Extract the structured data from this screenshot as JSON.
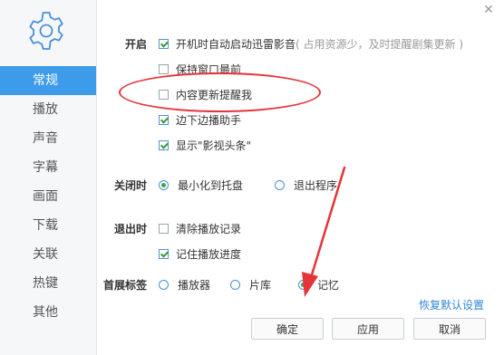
{
  "sidebar": {
    "items": [
      {
        "label": "常规",
        "active": true
      },
      {
        "label": "播放"
      },
      {
        "label": "声音"
      },
      {
        "label": "字幕"
      },
      {
        "label": "画面"
      },
      {
        "label": "下载"
      },
      {
        "label": "关联"
      },
      {
        "label": "热键"
      },
      {
        "label": "其他"
      }
    ]
  },
  "sections": {
    "startup": {
      "label": "开启",
      "options": [
        {
          "label": "开机时自动启动迅雷影音",
          "hint": "( 占用资源少，及时提醒剧集更新 )",
          "checked": true
        },
        {
          "label": "保持窗口最前",
          "checked": false
        },
        {
          "label": "内容更新提醒我",
          "checked": false
        },
        {
          "label": "边下边播助手",
          "checked": true
        },
        {
          "label": "显示\"影视头条\"",
          "checked": true
        }
      ]
    },
    "close": {
      "label": "关闭时",
      "options": [
        {
          "label": "最小化到托盘",
          "checked": true
        },
        {
          "label": "退出程序",
          "checked": false
        }
      ]
    },
    "exit": {
      "label": "退出时",
      "options": [
        {
          "label": "清除播放记录",
          "checked": false
        },
        {
          "label": "记住播放进度",
          "checked": true
        }
      ]
    },
    "home_tab": {
      "label": "首展标签",
      "options": [
        {
          "label": "播放器",
          "checked": false
        },
        {
          "label": "片库",
          "checked": false
        },
        {
          "label": "记忆",
          "checked": true
        }
      ]
    }
  },
  "restore_defaults": "恢复默认设置",
  "buttons": {
    "ok": "确定",
    "apply": "应用",
    "cancel": "取消"
  },
  "icons": {
    "settings": "gear-icon",
    "close": "close-icon"
  },
  "colors": {
    "accent": "#3d9be9",
    "annotation": "#e5343a",
    "check": "#2f9f3a",
    "link": "#2f86d8"
  }
}
